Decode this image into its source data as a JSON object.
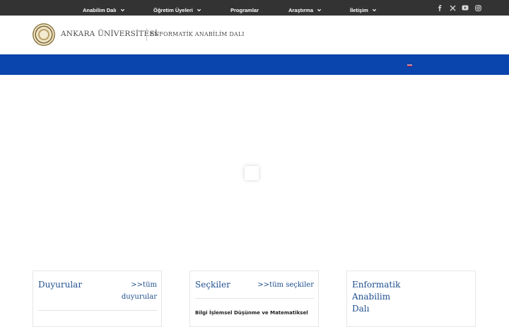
{
  "social": [
    {
      "name": "facebook-icon"
    },
    {
      "name": "x-icon"
    },
    {
      "name": "youtube-icon"
    },
    {
      "name": "instagram-icon"
    }
  ],
  "header": {
    "university": "ANKARA ÜNİVERSİTESİ",
    "department": "ENFORMATİK ANABİLİM DALI"
  },
  "nav": {
    "items": [
      {
        "label": "Anabilim Dalı",
        "dropdown": true
      },
      {
        "label": "Öğretim Üyeleri",
        "dropdown": true
      },
      {
        "label": "Programlar",
        "dropdown": false
      },
      {
        "label": "Araştırma",
        "dropdown": true
      },
      {
        "label": "İletişim",
        "dropdown": true
      }
    ],
    "language_flag": "english-flag-icon"
  },
  "cards": {
    "announcements": {
      "title": "Duyurular",
      "link": ">>tüm duyurular"
    },
    "highlights": {
      "title": "Seçkiler",
      "link": ">>tüm seçkiler",
      "first_item": "Bilgi İşlemsel Düşünme ve Matematiksel"
    },
    "department": {
      "title": "Enformatik Anabilim Dalı"
    }
  },
  "colors": {
    "topbar": "#333333",
    "nav": "#0a44ad",
    "accent_text": "#1f4f8f"
  }
}
